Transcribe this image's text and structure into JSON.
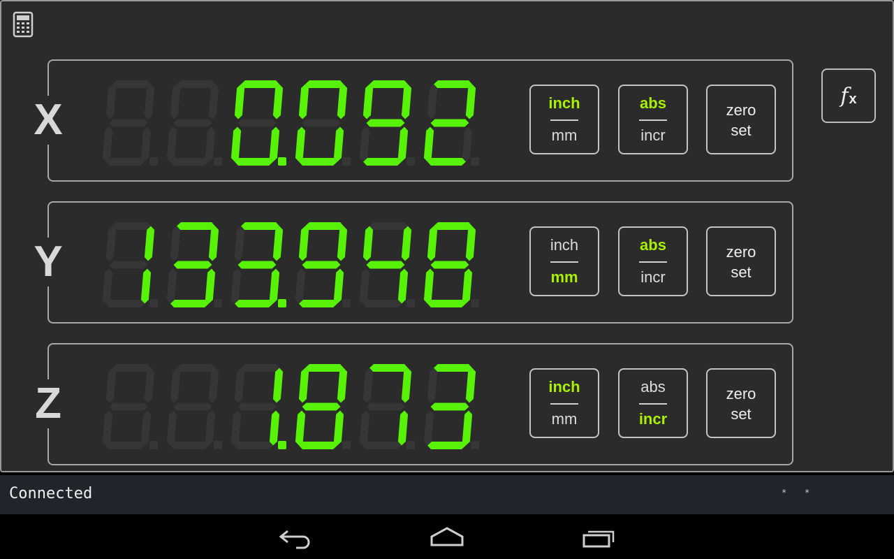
{
  "app": {
    "toolbar_icon": "calculator-icon",
    "fx_icon": "function-fx-icon",
    "fx_label": "f",
    "fx_sub": "x"
  },
  "colors": {
    "segment_on": "#57f208",
    "segment_ghost": "#363636",
    "active_label": "#a8f000",
    "frame_bg": "#2b2b2b"
  },
  "axes": [
    {
      "name": "X",
      "readout": "0.092",
      "ghost_width": 6,
      "unit": {
        "top": "inch",
        "bottom": "mm",
        "active": "top"
      },
      "mode": {
        "top": "abs",
        "bottom": "incr",
        "active": "top"
      },
      "zero": [
        "zero",
        "set"
      ]
    },
    {
      "name": "Y",
      "readout": "133.948",
      "ghost_width": 6,
      "unit": {
        "top": "inch",
        "bottom": "mm",
        "active": "bottom"
      },
      "mode": {
        "top": "abs",
        "bottom": "incr",
        "active": "top"
      },
      "zero": [
        "zero",
        "set"
      ]
    },
    {
      "name": "Z",
      "readout": "1.873",
      "ghost_width": 6,
      "unit": {
        "top": "inch",
        "bottom": "mm",
        "active": "top"
      },
      "mode": {
        "top": "abs",
        "bottom": "incr",
        "active": "bottom"
      },
      "zero": [
        "zero",
        "set"
      ]
    }
  ],
  "status": {
    "text": "Connected",
    "marks": [
      "*",
      "*"
    ]
  },
  "nav": {
    "icons": [
      "back-icon",
      "home-icon",
      "recent-apps-icon"
    ]
  }
}
